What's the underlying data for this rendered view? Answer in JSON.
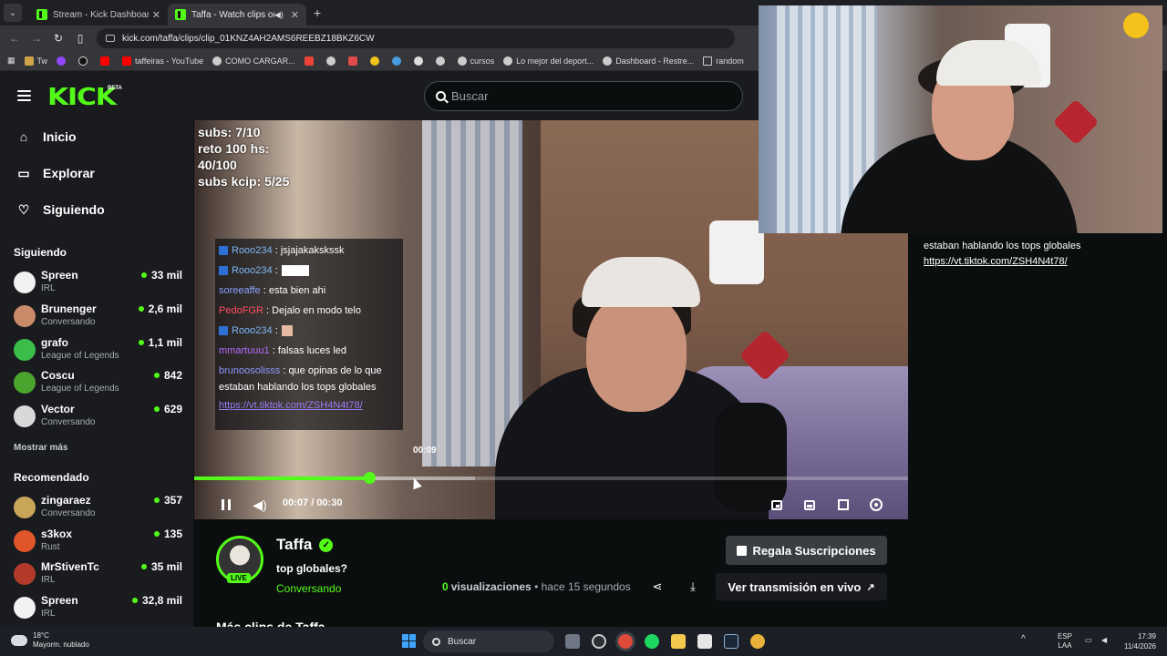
{
  "browser": {
    "tabs": [
      {
        "title": "Stream - Kick Dashboard",
        "active": false
      },
      {
        "title": "Taffa - Watch clips on Kick",
        "active": true
      }
    ],
    "url": "kick.com/taffa/clips/clip_01KNZ4AH2AMS6REEBZ18BKZ6CW",
    "bookmarks": [
      "Tw",
      "taffeiras - YouTube",
      "COMO CARGAR...",
      "cursos",
      "Lo mejor del deport...",
      "Dashboard - Restre...",
      "random"
    ]
  },
  "header": {
    "logo": "KICK",
    "beta": "BETA",
    "search_placeholder": "Buscar"
  },
  "sidebar": {
    "nav": [
      {
        "label": "Inicio",
        "icon": "home-icon"
      },
      {
        "label": "Explorar",
        "icon": "explore-icon"
      },
      {
        "label": "Siguiendo",
        "icon": "heart-icon"
      }
    ],
    "following_title": "Siguiendo",
    "following": [
      {
        "name": "Spreen",
        "category": "IRL",
        "viewers": "33 mil",
        "color": "#f2f2f2"
      },
      {
        "name": "Brunenger",
        "category": "Conversando",
        "viewers": "2,6 mil",
        "color": "#c98b6a"
      },
      {
        "name": "grafo",
        "category": "League of Legends",
        "viewers": "1,1 mil",
        "color": "#3bbd4a"
      },
      {
        "name": "Coscu",
        "category": "League of Legends",
        "viewers": "842",
        "color": "#4aa52e"
      },
      {
        "name": "Vector",
        "category": "Conversando",
        "viewers": "629",
        "color": "#d9d9d9"
      }
    ],
    "show_more": "Mostrar más",
    "recommended_title": "Recomendado",
    "recommended": [
      {
        "name": "zingaraez",
        "category": "Conversando",
        "viewers": "357",
        "color": "#c9a55a"
      },
      {
        "name": "s3kox",
        "category": "Rust",
        "viewers": "135",
        "color": "#e0562a"
      },
      {
        "name": "MrStivenTc",
        "category": "IRL",
        "viewers": "35 mil",
        "color": "#b33a2a"
      },
      {
        "name": "Spreen",
        "category": "IRL",
        "viewers": "32,8 mil",
        "color": "#f2f2f2"
      }
    ]
  },
  "video": {
    "overlay_stats": [
      "subs: 7/10",
      "reto 100 hs:",
      "40/100",
      "subs kcip: 5/25"
    ],
    "chat_overlay": [
      {
        "user": "Rooo234",
        "text": ": jsjajakakskssk"
      },
      {
        "user": "Rooo234",
        "text": ":"
      },
      {
        "user": "soreeaffe",
        "text": ": esta bien ahi"
      },
      {
        "user": "PedoFGR",
        "text": ": Dejalo en modo telo"
      },
      {
        "user": "Rooo234",
        "text": ":"
      },
      {
        "user": "mmartuuu1",
        "text": ": falsas luces led"
      },
      {
        "user": "brunoosolisss",
        "text": ": que opinas de lo que estaban hablando los tops globales"
      },
      {
        "user": "",
        "text": "https://vt.tiktok.com/ZSH4N4t78/"
      }
    ],
    "hover_time": "00:09",
    "time_current": "00:07",
    "time_total": "00:30",
    "progress_fraction": 0.245
  },
  "chat_panel": {
    "message_tail": "estaban hablando los tops globales",
    "link": "https://vt.tiktok.com/ZSH4N4t78/"
  },
  "clip": {
    "channel": "Taffa",
    "live_badge": "LIVE",
    "title": "top globales?",
    "category": "Conversando",
    "views_count": "0",
    "views_label": "visualizaciones",
    "time_ago": "• hace 15 segundos",
    "gift_button": "Regala Suscripciones",
    "watch_live_button": "Ver transmisión en vivo",
    "more_clips": "Más clips de Taffa"
  },
  "taskbar": {
    "temperature": "18°C",
    "weather": "Mayorm. nublado",
    "search": "Buscar",
    "lang_top": "ESP",
    "lang_bottom": "LAA",
    "time": "17:39",
    "date": "11/4/2026"
  },
  "colors": {
    "accent": "#53fc18",
    "background": "#0b0e0f",
    "panel": "#191b1f"
  }
}
